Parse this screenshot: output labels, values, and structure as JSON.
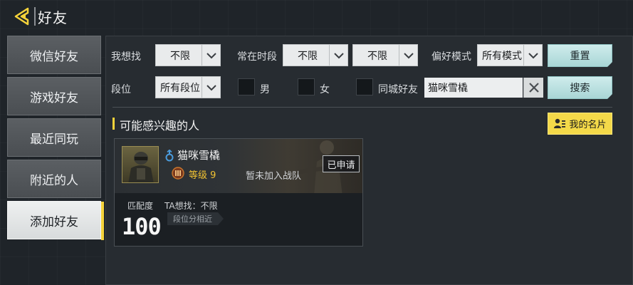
{
  "header": {
    "title": "好友"
  },
  "sidebar": {
    "items": [
      {
        "label": "微信好友"
      },
      {
        "label": "游戏好友"
      },
      {
        "label": "最近同玩"
      },
      {
        "label": "附近的人"
      },
      {
        "label": "添加好友",
        "active": true
      }
    ]
  },
  "filters": {
    "seek_label": "我想找",
    "seek_value": "不限",
    "active_time_label": "常在时段",
    "active_time_value1": "不限",
    "active_time_value2": "不限",
    "preferred_mode_label": "偏好模式",
    "preferred_mode_value": "所有模式",
    "rank_label": "段位",
    "rank_value": "所有段位",
    "male_label": "男",
    "female_label": "女",
    "same_city_label": "同城好友",
    "search_value": "猫咪雪橇",
    "reset_label": "重置",
    "search_label": "搜索"
  },
  "section": {
    "title": "可能感兴趣的人",
    "my_card_label": "我的名片"
  },
  "player": {
    "name": "猫咪雪橇",
    "level": "等级 9",
    "clan_status": "暂未加入战队",
    "applied_label": "已申请",
    "match_label": "匹配度",
    "match_value": "100",
    "seek_text": "TA想找：不限",
    "rank_tag": "段位分相近"
  },
  "colors": {
    "accent_yellow": "#f5d33a",
    "teal_button": "#a9d6d6",
    "level_gold": "#f1c232",
    "gender_blue": "#4a9bdc"
  },
  "icons": {
    "back": "back-arrow-icon",
    "clear": "close-icon",
    "card": "person-card-icon",
    "gender": "gender-icon",
    "rank": "rank-badge-icon"
  }
}
